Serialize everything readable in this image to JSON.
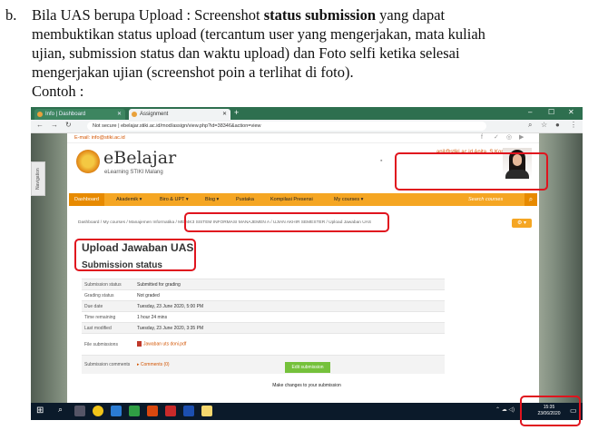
{
  "paragraph": {
    "bullet": "b.",
    "line1_pre": "Bila UAS berupa Upload : Screenshot ",
    "line1_bold": "status submission",
    "line1_post": "  yang dapat",
    "line2": "membuktikan status upload (tercantum user yang mengerjakan, mata kuliah",
    "line3": "ujian, submission status dan waktu upload) dan Foto selfi ketika selesai",
    "line4": "mengerjakan ujian (screenshot poin a terlihat di foto).",
    "line5": "Contoh :"
  },
  "browser": {
    "tab1": "Info | Dashboard",
    "tab2": "Assignment",
    "url": "Not secure  |  ebelajar.stiki.ac.id/mod/assign/view.php?id=38346&action=view"
  },
  "site": {
    "email": "E-mail: info@stiki.ac.id",
    "brand": "eBelajar",
    "brand_sub": "eLearning STIKI Malang",
    "user_name": "anil@stiki.ac.id Anita, S.Kom, M.T.",
    "user_role": "Student",
    "nav_tab": "Navigation",
    "menu": [
      "Dashboard",
      "Akademik ▾",
      "Biro & UPT ▾",
      "Blog ▾",
      "Pustaka",
      "Kompilasi Presensi",
      "My courses ▾"
    ],
    "search": "Search courses",
    "crumb_pre": "Dashboard / My courses / Manajemen Informatika / ",
    "crumb_box": "MEJ4K3 SISTEM INFORMASI MANAJEMEN A / UJIAN AKHIR SEMESTER / Upload Jawaban UAS",
    "h1": "Upload Jawaban UAS",
    "h2": "Submission status",
    "rows": [
      {
        "k": "Submission status",
        "v": "Submitted for grading"
      },
      {
        "k": "Grading status",
        "v": "Not graded"
      },
      {
        "k": "Due date",
        "v": "Tuesday, 23 June 2020, 5:00 PM"
      },
      {
        "k": "Time remaining",
        "v": "1 hour 24 mins"
      },
      {
        "k": "Last modified",
        "v": "Tuesday, 23 June 2020, 3:35 PM"
      }
    ],
    "files_label": "File submissions",
    "file_name": "Jawaban uts doni.pdf",
    "comments_label": "Submission comments",
    "comments_value": "Comments (0)",
    "edit_btn": "Edit submission",
    "note": "Make changes to your submission"
  },
  "taskbar": {
    "time": "15:35",
    "date": "23/06/2020"
  },
  "colors": {
    "highlight": "#e0141e",
    "menu": "#f5a623",
    "accent": "#d35400"
  }
}
